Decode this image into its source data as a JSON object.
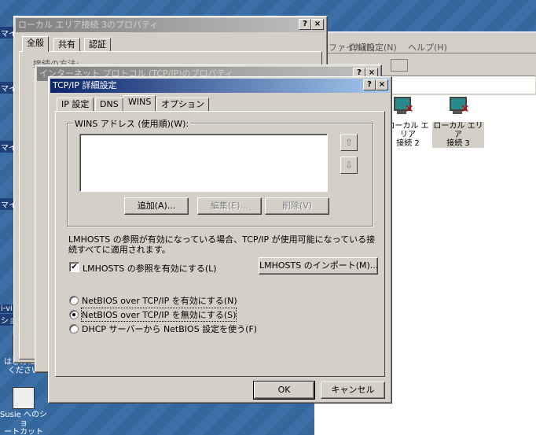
{
  "desktop": {
    "icons": [
      {
        "label_1": "はじめにお",
        "label_2": "ください"
      },
      {
        "label_1": "Susie へのショ",
        "label_2": "ートカット"
      }
    ],
    "clipped_labels": [
      "マイ",
      "マイ",
      "マイ",
      "マイ",
      "i-vi",
      "ショ"
    ]
  },
  "explorer": {
    "menu": [
      "ファイル(F)",
      "詳細設定(N)",
      "ヘルプ(H)"
    ],
    "items": [
      {
        "label_1": "ローカル エリア",
        "label_2": "接続 2"
      },
      {
        "label_1": "ローカル エリア",
        "label_2": "接続 3"
      }
    ]
  },
  "props_window": {
    "title": "ローカル エリア接続 3のプロパティ",
    "tabs": [
      "全般",
      "共有",
      "認証"
    ],
    "connect_label": "接続の方法:"
  },
  "tcpip_window": {
    "title": "インターネット プロトコル (TCP/IP)のプロパティ"
  },
  "adv_dialog": {
    "title": "TCP/IP 詳細設定",
    "help_glyph": "?",
    "close_glyph": "×",
    "tabs": [
      "IP 設定",
      "DNS",
      "WINS",
      "オプション"
    ],
    "active_tab": "WINS",
    "wins_group_label": "WINS アドレス (使用順)(W):",
    "up_glyph": "⇧",
    "down_glyph": "⇩",
    "add_button": "追加(A)...",
    "edit_button": "編集(E)...",
    "delete_button": "削除(V)",
    "lmhosts_text": "LMHOSTS の参照が有効になっている場合、TCP/IP が使用可能になっている接続すべてに適用されます。",
    "lmhosts_checkbox_label": "LMHOSTS の参照を有効にする(L)",
    "lmhosts_checked": true,
    "lmhosts_import_button": "LMHOSTS のインポート(M)...",
    "netbios_options": [
      {
        "label": "NetBIOS over TCP/IP を有効にする(N)",
        "selected": false
      },
      {
        "label": "NetBIOS over TCP/IP を無効にする(S)",
        "selected": true
      },
      {
        "label": "DHCP サーバーから NetBIOS 設定を使う(F)",
        "selected": false
      }
    ],
    "ok_button": "OK",
    "cancel_button": "キャンセル"
  }
}
